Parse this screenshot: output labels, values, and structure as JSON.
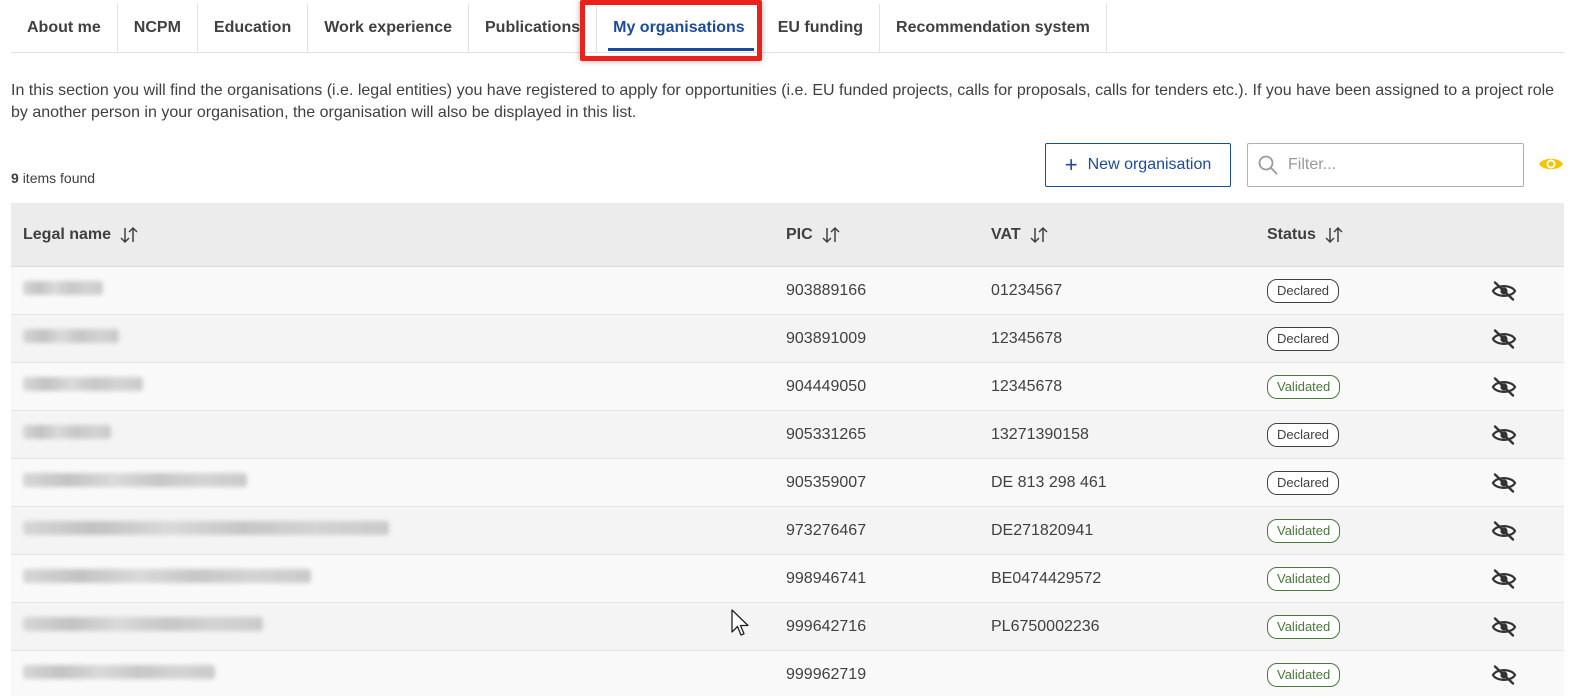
{
  "tabs": [
    {
      "label": "About me",
      "active": false
    },
    {
      "label": "NCPM",
      "active": false
    },
    {
      "label": "Education",
      "active": false
    },
    {
      "label": "Work experience",
      "active": false
    },
    {
      "label": "Publications",
      "active": false
    },
    {
      "label": "My organisations",
      "active": true
    },
    {
      "label": "EU funding",
      "active": false
    },
    {
      "label": "Recommendation system",
      "active": false
    }
  ],
  "intro_text": "In this section you will find the organisations (i.e. legal entities) you have registered to apply for opportunities (i.e. EU funded projects, calls for proposals, calls for tenders etc.). If you have been assigned to a project role by another person in your organisation, the organisation will also be displayed in this list.",
  "results": {
    "count": "9",
    "suffix": "items found"
  },
  "toolbar": {
    "new_button_label": "New organisation",
    "filter_placeholder": "Filter..."
  },
  "table": {
    "columns": [
      {
        "label": "Legal name"
      },
      {
        "label": "PIC"
      },
      {
        "label": "VAT"
      },
      {
        "label": "Status"
      }
    ],
    "rows": [
      {
        "pic": "903889166",
        "vat": "01234567",
        "status": "Declared"
      },
      {
        "pic": "903891009",
        "vat": "12345678",
        "status": "Declared"
      },
      {
        "pic": "904449050",
        "vat": "12345678",
        "status": "Validated"
      },
      {
        "pic": "905331265",
        "vat": "13271390158",
        "status": "Declared"
      },
      {
        "pic": "905359007",
        "vat": "DE 813 298 461",
        "status": "Declared"
      },
      {
        "pic": "973276467",
        "vat": "DE271820941",
        "status": "Validated"
      },
      {
        "pic": "998946741",
        "vat": "BE0474429572",
        "status": "Validated"
      },
      {
        "pic": "999642716",
        "vat": "PL6750002236",
        "status": "Validated"
      },
      {
        "pic": "999962719",
        "vat": "",
        "status": "Validated"
      }
    ]
  },
  "colors": {
    "accent": "#1c4b9c",
    "highlight": "#e8231e",
    "validated": "#467a39",
    "eye_toggle": "#f5c400"
  }
}
